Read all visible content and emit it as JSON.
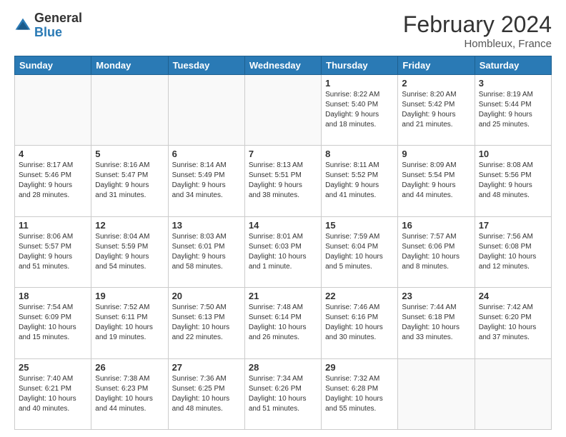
{
  "logo": {
    "general": "General",
    "blue": "Blue"
  },
  "header": {
    "month": "February 2024",
    "location": "Hombleux, France"
  },
  "weekdays": [
    "Sunday",
    "Monday",
    "Tuesday",
    "Wednesday",
    "Thursday",
    "Friday",
    "Saturday"
  ],
  "weeks": [
    [
      {
        "day": "",
        "info": ""
      },
      {
        "day": "",
        "info": ""
      },
      {
        "day": "",
        "info": ""
      },
      {
        "day": "",
        "info": ""
      },
      {
        "day": "1",
        "info": "Sunrise: 8:22 AM\nSunset: 5:40 PM\nDaylight: 9 hours\nand 18 minutes."
      },
      {
        "day": "2",
        "info": "Sunrise: 8:20 AM\nSunset: 5:42 PM\nDaylight: 9 hours\nand 21 minutes."
      },
      {
        "day": "3",
        "info": "Sunrise: 8:19 AM\nSunset: 5:44 PM\nDaylight: 9 hours\nand 25 minutes."
      }
    ],
    [
      {
        "day": "4",
        "info": "Sunrise: 8:17 AM\nSunset: 5:46 PM\nDaylight: 9 hours\nand 28 minutes."
      },
      {
        "day": "5",
        "info": "Sunrise: 8:16 AM\nSunset: 5:47 PM\nDaylight: 9 hours\nand 31 minutes."
      },
      {
        "day": "6",
        "info": "Sunrise: 8:14 AM\nSunset: 5:49 PM\nDaylight: 9 hours\nand 34 minutes."
      },
      {
        "day": "7",
        "info": "Sunrise: 8:13 AM\nSunset: 5:51 PM\nDaylight: 9 hours\nand 38 minutes."
      },
      {
        "day": "8",
        "info": "Sunrise: 8:11 AM\nSunset: 5:52 PM\nDaylight: 9 hours\nand 41 minutes."
      },
      {
        "day": "9",
        "info": "Sunrise: 8:09 AM\nSunset: 5:54 PM\nDaylight: 9 hours\nand 44 minutes."
      },
      {
        "day": "10",
        "info": "Sunrise: 8:08 AM\nSunset: 5:56 PM\nDaylight: 9 hours\nand 48 minutes."
      }
    ],
    [
      {
        "day": "11",
        "info": "Sunrise: 8:06 AM\nSunset: 5:57 PM\nDaylight: 9 hours\nand 51 minutes."
      },
      {
        "day": "12",
        "info": "Sunrise: 8:04 AM\nSunset: 5:59 PM\nDaylight: 9 hours\nand 54 minutes."
      },
      {
        "day": "13",
        "info": "Sunrise: 8:03 AM\nSunset: 6:01 PM\nDaylight: 9 hours\nand 58 minutes."
      },
      {
        "day": "14",
        "info": "Sunrise: 8:01 AM\nSunset: 6:03 PM\nDaylight: 10 hours\nand 1 minute."
      },
      {
        "day": "15",
        "info": "Sunrise: 7:59 AM\nSunset: 6:04 PM\nDaylight: 10 hours\nand 5 minutes."
      },
      {
        "day": "16",
        "info": "Sunrise: 7:57 AM\nSunset: 6:06 PM\nDaylight: 10 hours\nand 8 minutes."
      },
      {
        "day": "17",
        "info": "Sunrise: 7:56 AM\nSunset: 6:08 PM\nDaylight: 10 hours\nand 12 minutes."
      }
    ],
    [
      {
        "day": "18",
        "info": "Sunrise: 7:54 AM\nSunset: 6:09 PM\nDaylight: 10 hours\nand 15 minutes."
      },
      {
        "day": "19",
        "info": "Sunrise: 7:52 AM\nSunset: 6:11 PM\nDaylight: 10 hours\nand 19 minutes."
      },
      {
        "day": "20",
        "info": "Sunrise: 7:50 AM\nSunset: 6:13 PM\nDaylight: 10 hours\nand 22 minutes."
      },
      {
        "day": "21",
        "info": "Sunrise: 7:48 AM\nSunset: 6:14 PM\nDaylight: 10 hours\nand 26 minutes."
      },
      {
        "day": "22",
        "info": "Sunrise: 7:46 AM\nSunset: 6:16 PM\nDaylight: 10 hours\nand 30 minutes."
      },
      {
        "day": "23",
        "info": "Sunrise: 7:44 AM\nSunset: 6:18 PM\nDaylight: 10 hours\nand 33 minutes."
      },
      {
        "day": "24",
        "info": "Sunrise: 7:42 AM\nSunset: 6:20 PM\nDaylight: 10 hours\nand 37 minutes."
      }
    ],
    [
      {
        "day": "25",
        "info": "Sunrise: 7:40 AM\nSunset: 6:21 PM\nDaylight: 10 hours\nand 40 minutes."
      },
      {
        "day": "26",
        "info": "Sunrise: 7:38 AM\nSunset: 6:23 PM\nDaylight: 10 hours\nand 44 minutes."
      },
      {
        "day": "27",
        "info": "Sunrise: 7:36 AM\nSunset: 6:25 PM\nDaylight: 10 hours\nand 48 minutes."
      },
      {
        "day": "28",
        "info": "Sunrise: 7:34 AM\nSunset: 6:26 PM\nDaylight: 10 hours\nand 51 minutes."
      },
      {
        "day": "29",
        "info": "Sunrise: 7:32 AM\nSunset: 6:28 PM\nDaylight: 10 hours\nand 55 minutes."
      },
      {
        "day": "",
        "info": ""
      },
      {
        "day": "",
        "info": ""
      }
    ]
  ]
}
